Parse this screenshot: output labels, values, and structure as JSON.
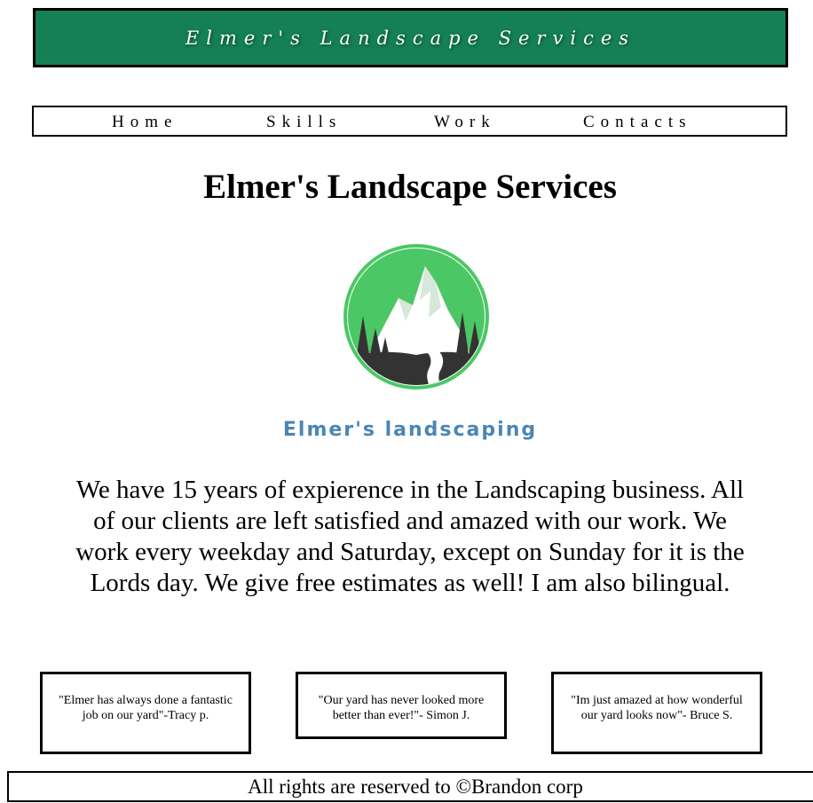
{
  "banner": {
    "title": "Elmer's Landscape Services"
  },
  "nav": {
    "items": [
      {
        "label": "Home"
      },
      {
        "label": "Skills"
      },
      {
        "label": "Work"
      },
      {
        "label": "Contacts"
      }
    ]
  },
  "main": {
    "heading": "Elmer's Landscape Services",
    "logo_text": "Elmer's landscaping",
    "intro": "We have 15 years of expierence in the Landscaping business. All of our clients are left satisfied and amazed with our work. We work every weekday and Saturday, except on Sunday for it is the Lords day. We give free estimates as well! I am also bilingual."
  },
  "testimonials": [
    {
      "quote": "\"Elmer has always done a fantastic job on our yard\"-Tracy p."
    },
    {
      "quote": "\"Our yard has never looked more better than ever!\"- Simon J."
    },
    {
      "quote": "\"Im just amazed at how wonderful our yard looks now\"- Bruce S."
    }
  ],
  "footer": {
    "text": "All rights are reserved to ©Brandon corp"
  },
  "colors": {
    "banner_green": "#148053",
    "logo_green": "#4cc765",
    "logo_dark": "#333333",
    "logo_text_blue": "#4a86b4"
  },
  "icons": {
    "logo": "mountain-landscape-logo-icon"
  }
}
